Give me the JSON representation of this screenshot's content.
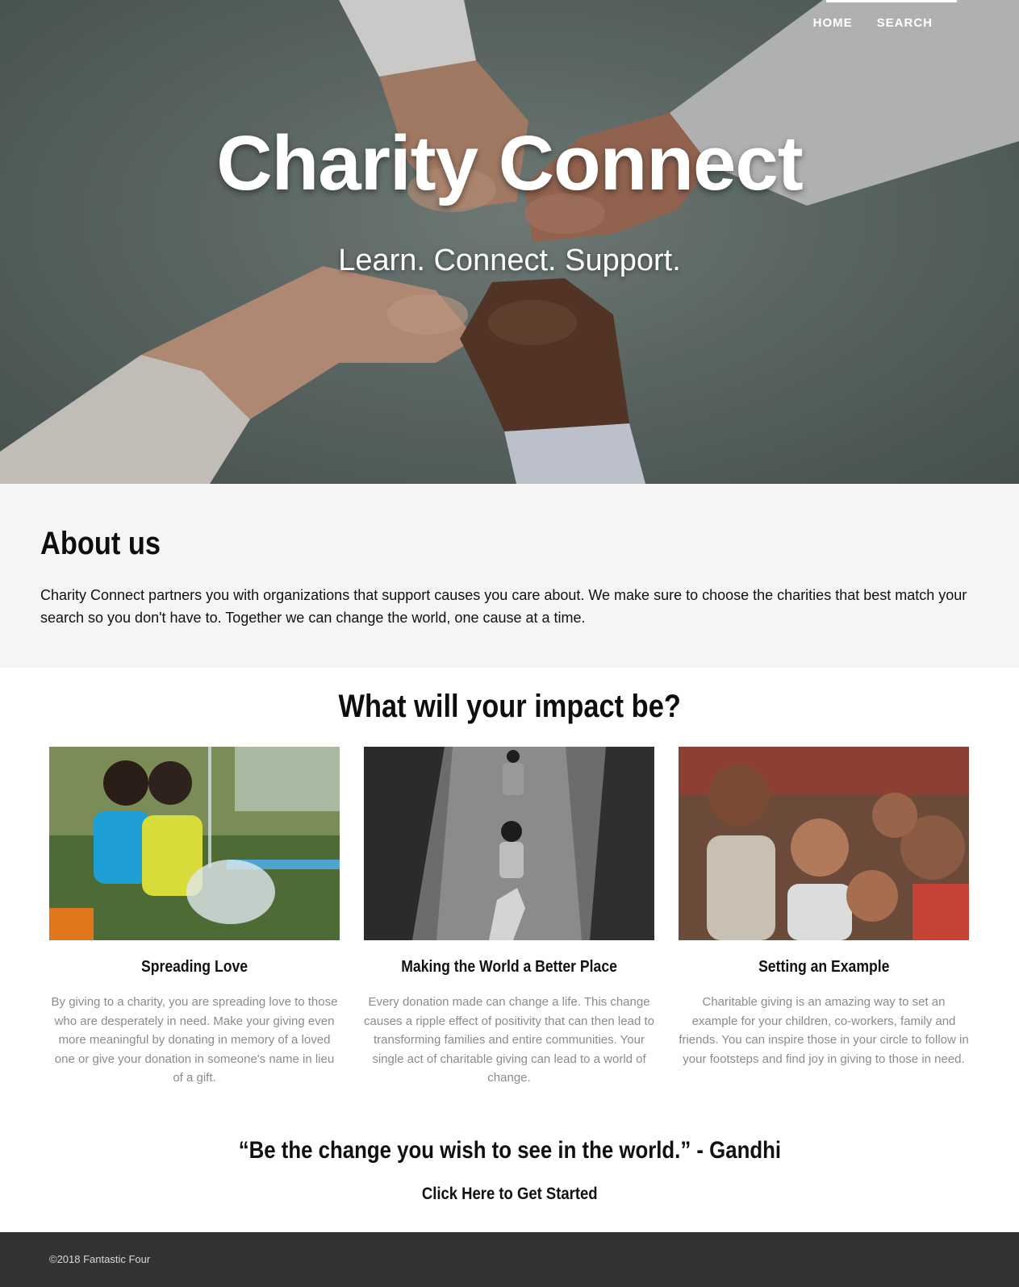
{
  "nav": {
    "items": [
      "HOME",
      "SEARCH"
    ],
    "active_index": 0
  },
  "hero": {
    "title": "Charity Connect",
    "subtitle": "Learn. Connect. Support."
  },
  "about": {
    "title": "About us",
    "text": "Charity Connect partners you with organizations that support causes you care about. We make sure to choose the charities that best match your search so you don't have to. Together we can change the world, one cause at a time."
  },
  "impact": {
    "title": "What will your impact be?",
    "cards": [
      {
        "title": "Spreading Love",
        "text": "By giving to a charity, you are spreading love to those who are desperately in need. Make your giving even more meaningful by donating in memory of a loved one or give your donation in someone's name in lieu of a gift."
      },
      {
        "title": "Making the World a Better Place",
        "text": "Every donation made can change a life. This change causes a ripple effect of positivity that can then lead to transforming families and entire communities. Your single act of charitable giving can lead to a world of change."
      },
      {
        "title": "Setting an Example",
        "text": "Charitable giving is an amazing way to set an example for your children, co-workers, family and friends. You can inspire those in your circle to follow in your footsteps and find joy in giving to those in need."
      }
    ]
  },
  "quote": "“Be the change you wish to see in the world.” - Gandhi",
  "cta": "Click Here to Get Started",
  "footer": {
    "copyright": "©2018 Fantastic Four"
  }
}
